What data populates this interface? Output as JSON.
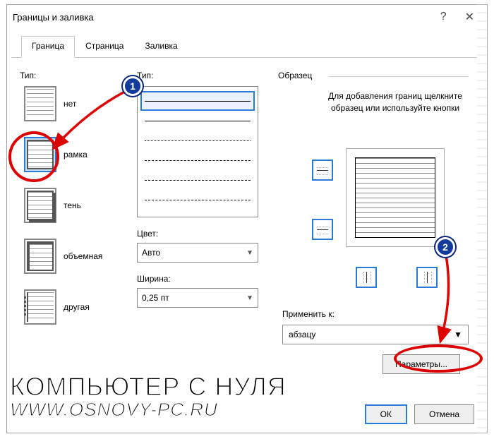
{
  "dialog": {
    "title": "Границы и заливка"
  },
  "tabs": {
    "border": "Граница",
    "page": "Страница",
    "fill": "Заливка"
  },
  "labels": {
    "type": "Тип:",
    "style": "Тип:",
    "color": "Цвет:",
    "width": "Ширина:",
    "sample": "Образец",
    "sample_hint": "Для добавления границ щелкните образец или используйте кнопки",
    "apply_to": "Применить к:"
  },
  "type_options": {
    "none": "нет",
    "box": "рамка",
    "shadow": "тень",
    "threeD": "объемная",
    "custom": "другая"
  },
  "color": {
    "value": "Авто"
  },
  "width": {
    "value": "0,25 пт"
  },
  "apply": {
    "value": "абзацу"
  },
  "buttons": {
    "options": "Параметры...",
    "ok": "ОК",
    "cancel": "Отмена"
  },
  "annotations": {
    "badge1": "1",
    "badge2": "2"
  },
  "watermark": {
    "line1": "КОМПЬЮТЕР С НУЛЯ",
    "line2": "WWW.OSNOVY-PC.RU"
  }
}
